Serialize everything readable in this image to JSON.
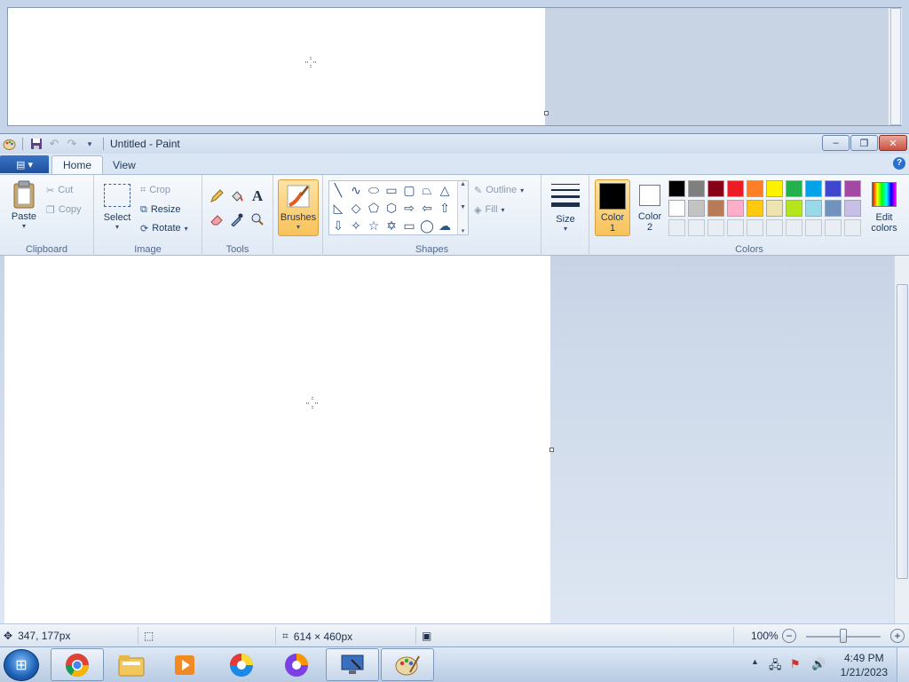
{
  "window": {
    "title": "Untitled - Paint",
    "minimize": "‒",
    "restore": "❐",
    "close": "✕"
  },
  "ribbon": {
    "file_menu": "▤ ▾",
    "tabs": [
      {
        "label": "Home",
        "active": true
      },
      {
        "label": "View",
        "active": false
      }
    ],
    "help": "?",
    "clipboard": {
      "label": "Clipboard",
      "paste": "Paste",
      "cut": "Cut",
      "copy": "Copy"
    },
    "image": {
      "label": "Image",
      "select": "Select",
      "crop": "Crop",
      "resize": "Resize",
      "rotate": "Rotate"
    },
    "tools": {
      "label": "Tools"
    },
    "brushes": {
      "label": "Brushes"
    },
    "shapes": {
      "label": "Shapes",
      "outline": "Outline",
      "fill": "Fill"
    },
    "size": {
      "label": "Size"
    },
    "colors": {
      "label": "Colors",
      "color1_a": "Color",
      "color1_b": "1",
      "color2_a": "Color",
      "color2_b": "2",
      "edit_a": "Edit",
      "edit_b": "colors",
      "color1_value": "#000000",
      "color2_value": "#ffffff",
      "palette_row1": [
        "#000000",
        "#7f7f7f",
        "#880015",
        "#ed1c24",
        "#ff7f27",
        "#fff200",
        "#22b14c",
        "#00a2e8",
        "#3f48cc",
        "#a349a4"
      ],
      "palette_row2": [
        "#ffffff",
        "#c3c3c3",
        "#b97a57",
        "#ffaec9",
        "#ffc90e",
        "#efe4b0",
        "#b5e61d",
        "#99d9ea",
        "#7092be",
        "#c8bfe7"
      ]
    }
  },
  "status": {
    "cursor_pos": "347, 177px",
    "canvas_size": "614 × 460px",
    "zoom": "100%",
    "zoom_minus": "−",
    "zoom_plus": "+"
  },
  "taskbar": {
    "time": "4:49 PM",
    "date": "1/21/2023"
  }
}
